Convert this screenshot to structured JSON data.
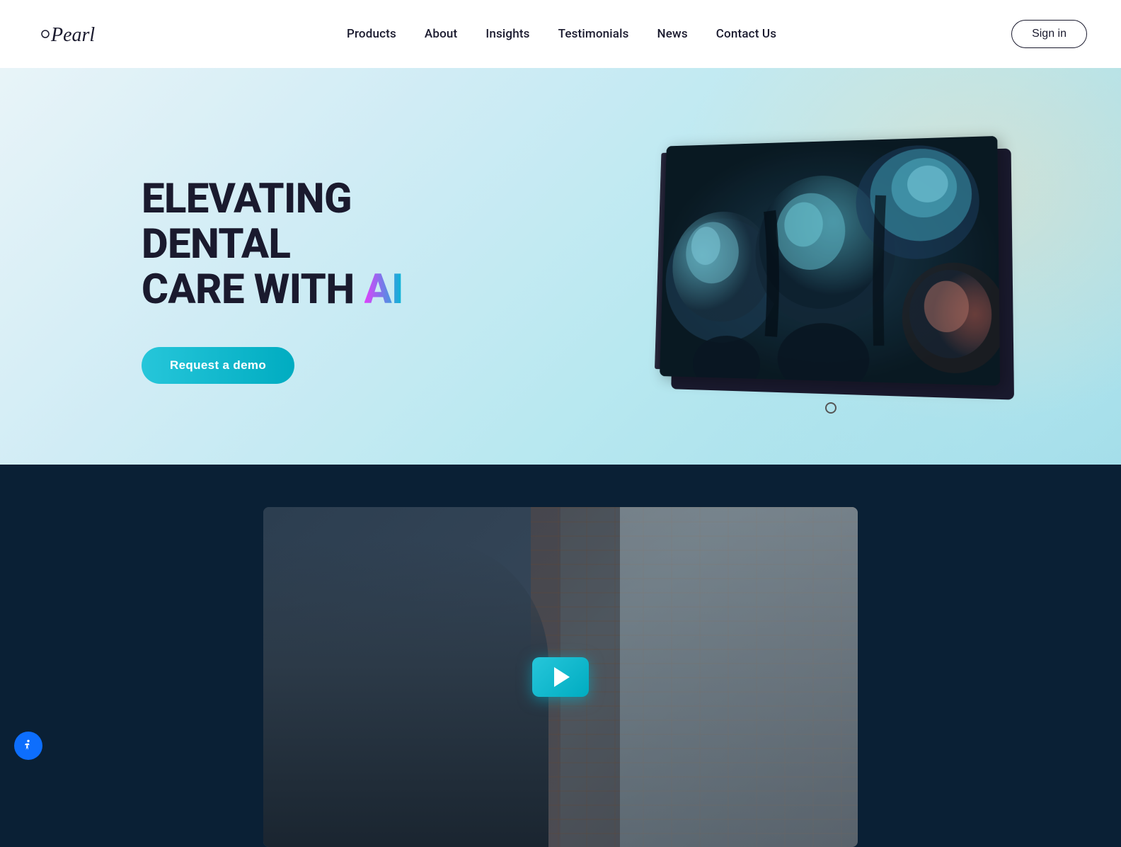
{
  "header": {
    "logo_alt": "Pearl",
    "nav_items": [
      {
        "id": "products",
        "label": "Products"
      },
      {
        "id": "about",
        "label": "About"
      },
      {
        "id": "insights",
        "label": "Insights"
      },
      {
        "id": "testimonials",
        "label": "Testimonials"
      },
      {
        "id": "news",
        "label": "News"
      },
      {
        "id": "contact",
        "label": "Contact Us"
      }
    ],
    "sign_in": "Sign in"
  },
  "hero": {
    "title_line1": "ELEVATING DENTAL",
    "title_line2": "CARE WITH ",
    "title_ai": "AI",
    "cta_label": "Request a demo"
  },
  "video_section": {
    "play_label": "Play video"
  },
  "accessibility": {
    "label": "Accessibility"
  }
}
